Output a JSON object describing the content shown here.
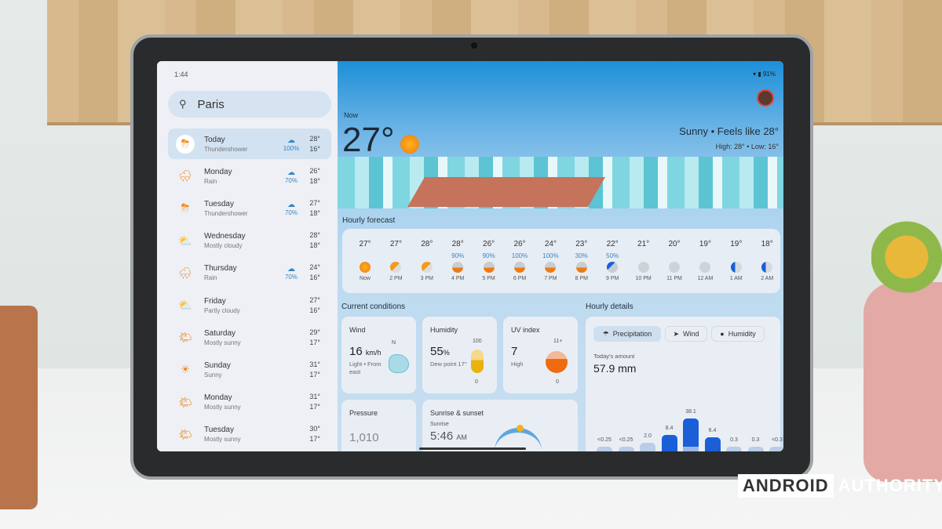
{
  "status_bar": {
    "time": "1:44",
    "battery": "91%"
  },
  "sidebar": {
    "location": "Paris",
    "days": [
      {
        "name": "Today",
        "condition": "Thundershower",
        "precip": "100%",
        "high": "28°",
        "low": "16°",
        "icon": "thunderstorm-icon",
        "selected": true
      },
      {
        "name": "Monday",
        "condition": "Rain",
        "precip": "70%",
        "high": "26°",
        "low": "18°",
        "icon": "rain-icon"
      },
      {
        "name": "Tuesday",
        "condition": "Thundershower",
        "precip": "70%",
        "high": "27°",
        "low": "18°",
        "icon": "thunderstorm-icon"
      },
      {
        "name": "Wednesday",
        "condition": "Mostly cloudy",
        "precip": "",
        "high": "28°",
        "low": "18°",
        "icon": "mostly-cloudy-icon"
      },
      {
        "name": "Thursday",
        "condition": "Rain",
        "precip": "70%",
        "high": "24°",
        "low": "16°",
        "icon": "rain-icon"
      },
      {
        "name": "Friday",
        "condition": "Partly cloudy",
        "precip": "",
        "high": "27°",
        "low": "16°",
        "icon": "partly-cloudy-icon"
      },
      {
        "name": "Saturday",
        "condition": "Mostly sunny",
        "precip": "",
        "high": "29°",
        "low": "17°",
        "icon": "mostly-sunny-icon"
      },
      {
        "name": "Sunday",
        "condition": "Sunny",
        "precip": "",
        "high": "31°",
        "low": "17°",
        "icon": "sunny-icon"
      },
      {
        "name": "Monday",
        "condition": "Mostly sunny",
        "precip": "",
        "high": "31°",
        "low": "17°",
        "icon": "mostly-sunny-icon"
      },
      {
        "name": "Tuesday",
        "condition": "Mostly sunny",
        "precip": "",
        "high": "30°",
        "low": "17°",
        "icon": "mostly-sunny-icon"
      }
    ]
  },
  "current": {
    "label": "Now",
    "temp": "27°",
    "condition": "Sunny • Feels like 28°",
    "high_low": "High: 28° • Low: 16°"
  },
  "hourly": {
    "title": "Hourly forecast",
    "hours": [
      {
        "time": "Now",
        "temp": "27°",
        "precip": "",
        "icon": "sunny"
      },
      {
        "time": "2 PM",
        "temp": "27°",
        "precip": "",
        "icon": "partly"
      },
      {
        "time": "3 PM",
        "temp": "28°",
        "precip": "",
        "icon": "partly"
      },
      {
        "time": "4 PM",
        "temp": "28°",
        "precip": "90%",
        "icon": "storm"
      },
      {
        "time": "5 PM",
        "temp": "26°",
        "precip": "90%",
        "icon": "storm"
      },
      {
        "time": "6 PM",
        "temp": "26°",
        "precip": "100%",
        "icon": "storm"
      },
      {
        "time": "7 PM",
        "temp": "24°",
        "precip": "100%",
        "icon": "storm"
      },
      {
        "time": "8 PM",
        "temp": "23°",
        "precip": "30%",
        "icon": "storm"
      },
      {
        "time": "9 PM",
        "temp": "22°",
        "precip": "50%",
        "icon": "storm-rain"
      },
      {
        "time": "10 PM",
        "temp": "21°",
        "precip": "",
        "icon": "cloudy"
      },
      {
        "time": "11 PM",
        "temp": "20°",
        "precip": "",
        "icon": "cloudy"
      },
      {
        "time": "12 AM",
        "temp": "19°",
        "precip": "",
        "icon": "cloudy"
      },
      {
        "time": "1 AM",
        "temp": "19°",
        "precip": "",
        "icon": "night"
      },
      {
        "time": "2 AM",
        "temp": "18°",
        "precip": "",
        "icon": "night"
      }
    ]
  },
  "conditions": {
    "title": "Current conditions",
    "wind": {
      "title": "Wind",
      "value": "16",
      "unit": "km/h",
      "desc": "Light • From east",
      "compass": "N"
    },
    "humidity": {
      "title": "Humidity",
      "value": "55",
      "unit": "%",
      "desc": "Dew point 17°",
      "max": "100",
      "min": "0",
      "level": 55
    },
    "uv": {
      "title": "UV index",
      "value": "7",
      "desc": "High",
      "max": "11+",
      "min": "0",
      "level": 7
    },
    "pressure": {
      "title": "Pressure",
      "value": "1,010"
    },
    "sun": {
      "title": "Sunrise & sunset",
      "sub": "Sunrise",
      "value": "5:46",
      "ampm": "AM"
    }
  },
  "details": {
    "title": "Hourly details",
    "tabs": [
      "Precipitation",
      "Wind",
      "Humidity"
    ],
    "amount_label": "Today's amount",
    "amount": "57.9 mm",
    "bars": {
      "labels": [
        "<0.25",
        "<0.25",
        "2.0",
        "8.4",
        "38.1",
        "6.4",
        "0.3",
        "0.3",
        "<0.3"
      ],
      "values": [
        0.1,
        0.1,
        2.0,
        8.4,
        38.1,
        6.4,
        0.3,
        0.3,
        0.2
      ]
    }
  },
  "colors": {
    "accent": "#3a86c2",
    "bar": "#1a5fd8",
    "sun": "#f59a1a"
  },
  "watermark": "ANDROID AUTHORITY"
}
